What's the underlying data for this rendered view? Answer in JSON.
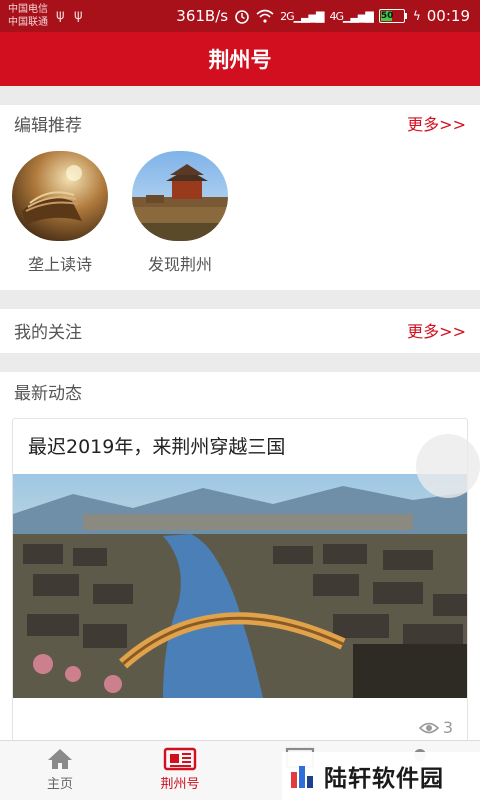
{
  "status_bar": {
    "carrier_1": "中国电信",
    "carrier_2": "中国联通",
    "speed": "361B/s",
    "signal_1": "2G",
    "signal_2": "4G",
    "battery": "50",
    "time": "00:19"
  },
  "header": {
    "title": "荆州号"
  },
  "editor_picks": {
    "title": "编辑推荐",
    "more": "更多>>",
    "items": [
      {
        "label": "垄上读诗"
      },
      {
        "label": "发现荆州"
      }
    ]
  },
  "following": {
    "title": "我的关注",
    "more": "更多>>"
  },
  "latest": {
    "title": "最新动态",
    "article": {
      "title": "最迟2019年，来荆州穿越三国",
      "views": "3"
    }
  },
  "bottom_nav": {
    "items": [
      {
        "label": "主页",
        "icon": "home-icon"
      },
      {
        "label": "荆州号",
        "icon": "newspaper-icon"
      }
    ]
  },
  "watermark": {
    "text": "陆轩软件园"
  },
  "colors": {
    "brand_red": "#d10f1e",
    "status_red": "#a8101a"
  }
}
